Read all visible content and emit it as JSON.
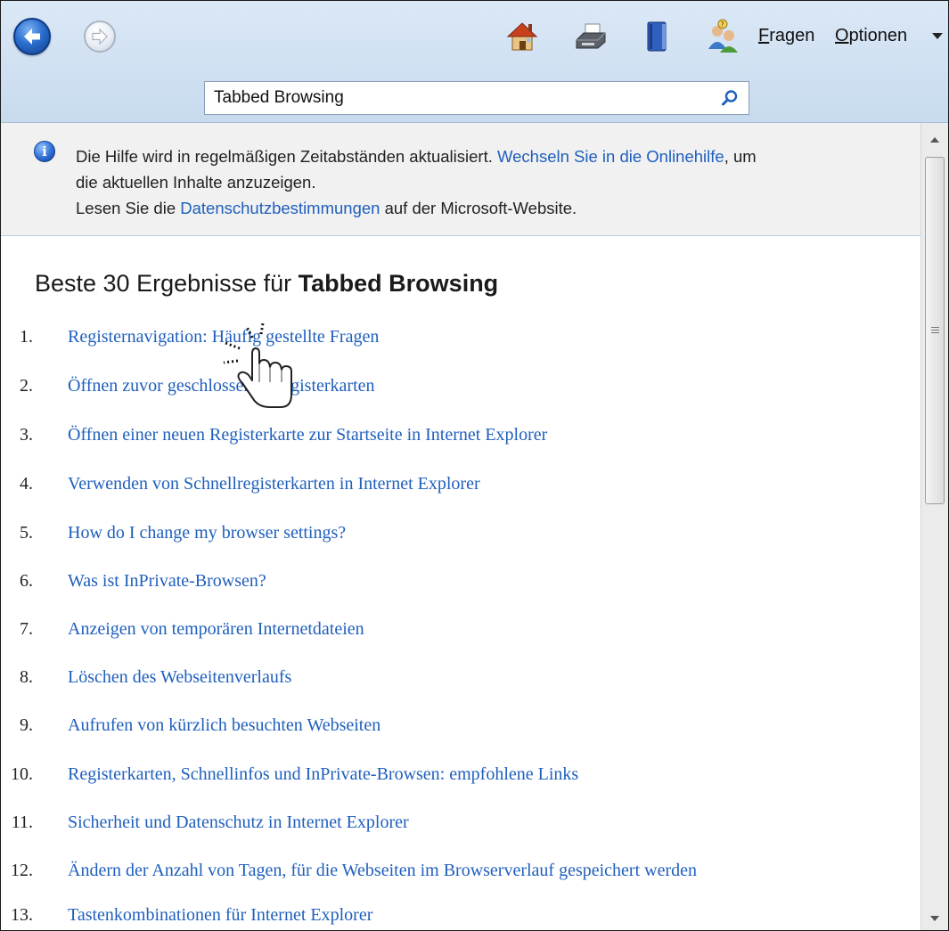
{
  "toolbar": {
    "back_icon": "back-arrow-icon",
    "forward_icon": "forward-arrow-icon",
    "icons": [
      "home-icon",
      "print-icon",
      "browse-help-icon",
      "ask-icon"
    ],
    "menu": {
      "fragen_accel": "F",
      "fragen_rest": "ragen",
      "optionen_accel": "O",
      "optionen_rest": "ptionen"
    }
  },
  "search": {
    "value": "Tabbed Browsing",
    "button_icon": "search-icon"
  },
  "info": {
    "icon": "info-icon",
    "line1_a": "Die Hilfe wird in regelmäßigen Zeitabständen aktualisiert. ",
    "line1_link": "Wechseln Sie in die Onlinehilfe",
    "line1_b": ", um",
    "line2": "die aktuellen Inhalte anzuzeigen.",
    "line3_a": "Lesen Sie die ",
    "line3_link": "Datenschutzbestimmungen",
    "line3_b": " auf der Microsoft-Website."
  },
  "results": {
    "title_prefix": "Beste 30 Ergebnisse für ",
    "title_query": "Tabbed Browsing",
    "items": [
      {
        "num": "1.",
        "label": "Registernavigation: Häufig gestellte Fragen"
      },
      {
        "num": "2.",
        "label": "Öffnen zuvor geschlossener Registerkarten"
      },
      {
        "num": "3.",
        "label": "Öffnen einer neuen Registerkarte zur Startseite in Internet Explorer"
      },
      {
        "num": "4.",
        "label": "Verwenden von Schnellregisterkarten in Internet Explorer"
      },
      {
        "num": "5.",
        "label": "How do I change my browser settings?"
      },
      {
        "num": "6.",
        "label": "Was ist InPrivate-Browsen?"
      },
      {
        "num": "7.",
        "label": "Anzeigen von temporären Internetdateien"
      },
      {
        "num": "8.",
        "label": "Löschen des Webseitenverlaufs"
      },
      {
        "num": "9.",
        "label": "Aufrufen von kürzlich besuchten Webseiten"
      },
      {
        "num": "10.",
        "label": "Registerkarten, Schnellinfos und InPrivate-Browsen: empfohlene Links"
      },
      {
        "num": "11.",
        "label": "Sicherheit und Datenschutz in Internet Explorer"
      },
      {
        "num": "12.",
        "label": "Ändern der Anzahl von Tagen, für die Webseiten im Browserverlauf gespeichert werden"
      },
      {
        "num": "13.",
        "label": "Tastenkombinationen für Internet Explorer"
      }
    ]
  },
  "colors": {
    "link": "#1f5fbd",
    "toolbar_bg": "#d2e2f3",
    "infobar_bg": "#f1f1f1"
  }
}
